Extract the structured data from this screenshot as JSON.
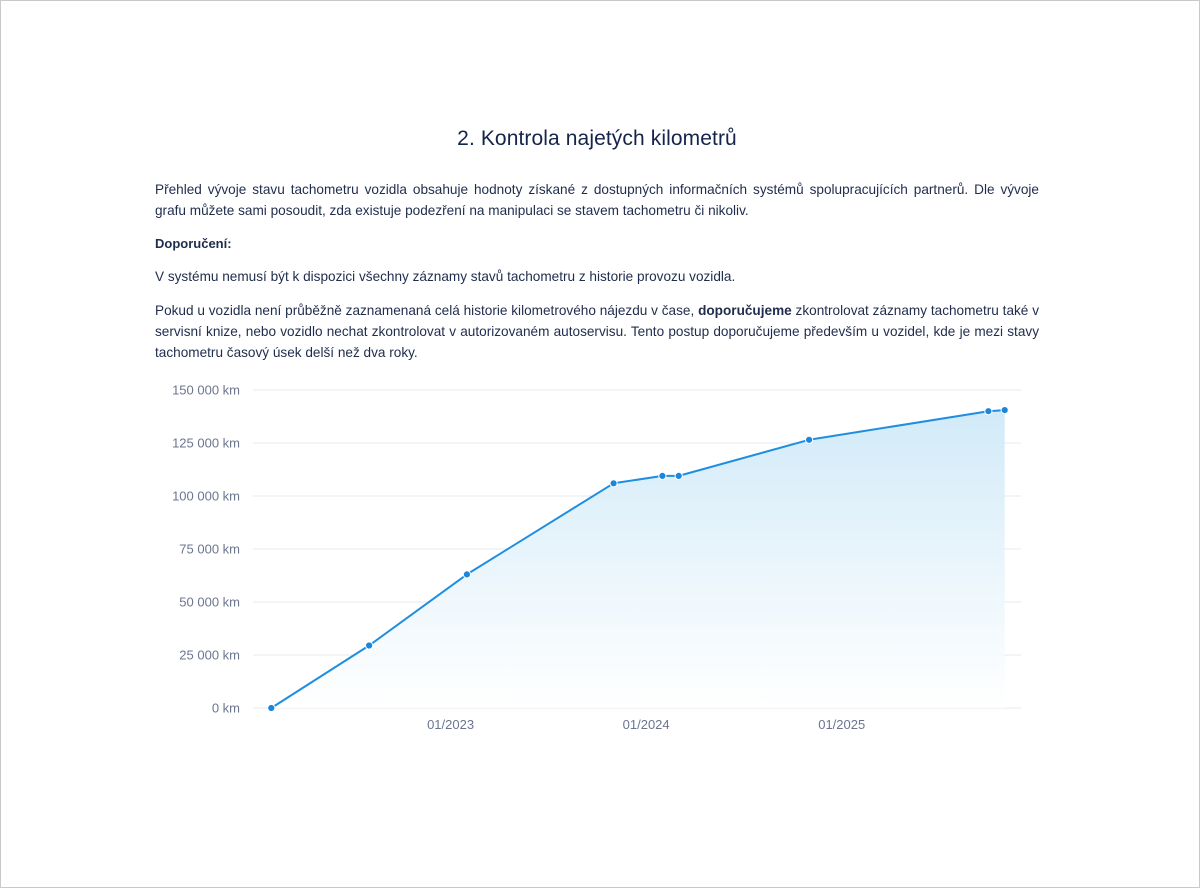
{
  "document": {
    "title": "2. Kontrola najetých kilometrů",
    "intro": "Přehled vývoje stavu tachometru vozidla obsahuje hodnoty získané z dostupných informačních systémů spolupracujících partnerů. Dle vývoje grafu můžete sami posoudit, zda existuje podezření na manipulaci se stavem tachometru či nikoliv.",
    "recommendation_heading": "Doporučení:",
    "note": "V systému nemusí být k dispozici všechny záznamy stavů tachometru z historie provozu vozidla.",
    "recommendation_part1": "Pokud u vozidla není průběžně zaznamenaná celá historie kilometrového nájezdu v čase, ",
    "recommendation_bold": "doporučujeme",
    "recommendation_part2": " zkontrolovat záznamy tachometru také v servisní knize, nebo vozidlo nechat zkontrolovat v autorizovaném autoservisu. Tento postup doporučujeme především u vozidel, kde je mezi stavy tachometru časový úsek delší než dva roky."
  },
  "colors": {
    "line": "#1f8ee0",
    "point": "#1a86dc",
    "area_top": "#cfe9f8",
    "area_bottom": "#ffffff",
    "grid": "#e6e9ef"
  },
  "chart_data": {
    "type": "area",
    "x_axis": {
      "type": "date",
      "range": [
        "2022-01",
        "2025-12"
      ],
      "ticks": [
        {
          "date": "2023-01",
          "label": "01/2023"
        },
        {
          "date": "2024-01",
          "label": "01/2024"
        },
        {
          "date": "2025-01",
          "label": "01/2025"
        }
      ]
    },
    "y_axis": {
      "range": [
        0,
        150000
      ],
      "ticks": [
        {
          "value": 0,
          "label": "0 km"
        },
        {
          "value": 25000,
          "label": "25 000 km"
        },
        {
          "value": 50000,
          "label": "50 000 km"
        },
        {
          "value": 75000,
          "label": "75 000 km"
        },
        {
          "value": 100000,
          "label": "100 000 km"
        },
        {
          "value": 125000,
          "label": "125 000 km"
        },
        {
          "value": 150000,
          "label": "150 000 km"
        }
      ]
    },
    "grid": true,
    "points": [
      {
        "date": "2022-02",
        "value": 0
      },
      {
        "date": "2022-08",
        "value": 29500
      },
      {
        "date": "2023-02",
        "value": 63000
      },
      {
        "date": "2023-11",
        "value": 106000
      },
      {
        "date": "2024-02",
        "value": 109500
      },
      {
        "date": "2024-03",
        "value": 109500
      },
      {
        "date": "2024-11",
        "value": 126500
      },
      {
        "date": "2025-10",
        "value": 140000
      },
      {
        "date": "2025-11",
        "value": 140500
      }
    ]
  }
}
